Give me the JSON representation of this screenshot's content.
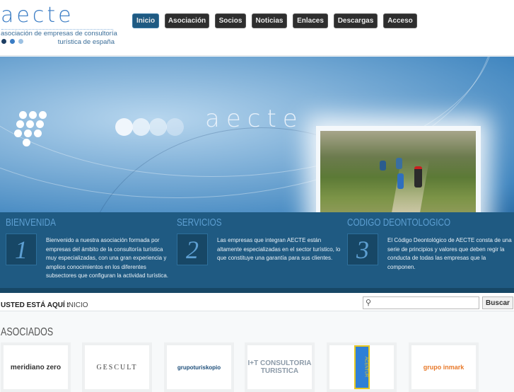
{
  "logo": {
    "word": "aecte",
    "line1": "asociación de empresas de consultoría",
    "line2": "turística de españa"
  },
  "nav": [
    {
      "label": "Inicio",
      "active": true
    },
    {
      "label": "Asociación"
    },
    {
      "label": "Socios"
    },
    {
      "label": "Noticias"
    },
    {
      "label": "Enlaces"
    },
    {
      "label": "Descargas"
    },
    {
      "label": "Acceso"
    }
  ],
  "hero": {
    "word": "aecte"
  },
  "columns": [
    {
      "title": "BIENVENIDA",
      "number": "1",
      "text": "Bienvenido a nuestra asociación formada por empresas del ámbito de la consultoría turística muy especializadas, con una gran experiencia y amplios conocimientos en los diferentes subsectores que configuran la actividad turística."
    },
    {
      "title": "SERVICIOS",
      "number": "2",
      "text": "Las empresas que integran AECTE están altamente especializadas en el sector turístico, lo que constituye una garantía para sus clientes."
    },
    {
      "title": "CODIGO DEONTOLOGICO",
      "number": "3",
      "text": "El Código Deontológico de AECTE consta de una serie de principios y valores que deben regir la conducta de todas las empresas que la componen."
    }
  ],
  "breadcrumb": {
    "label": "USTED ESTÁ AQUÍ :",
    "current": "INICIO"
  },
  "search": {
    "placeholder": "",
    "button": "Buscar"
  },
  "asociados": {
    "title": "ASOCIADOS",
    "logos": [
      "meridiano zero",
      "GESCULT",
      "grupoturiskopio",
      "I+T CONSULTORIA TURISTICA",
      "ACENTUR",
      "grupo inmark"
    ]
  },
  "colors": {
    "brand": "#1f5a82",
    "nav_dark": "#2e2e2e"
  }
}
